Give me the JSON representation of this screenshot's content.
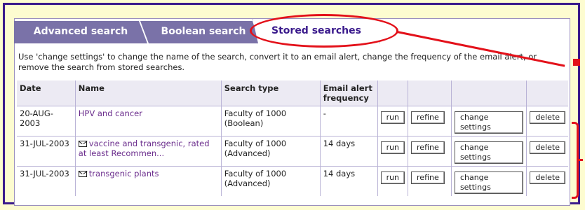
{
  "tabs": [
    {
      "label": "Advanced search"
    },
    {
      "label": "Boolean search"
    },
    {
      "label": "Stored searches"
    }
  ],
  "intro": "Use 'change settings' to change the name of the search, convert it to an email alert, change the frequency of the email alert, or remove the search from stored searches.",
  "table": {
    "headers": {
      "date": "Date",
      "name": "Name",
      "type": "Search type",
      "freq_line1": "Email alert",
      "freq_line2": "frequency"
    },
    "rows": [
      {
        "date": "20-AUG-2003",
        "email_alert": false,
        "name": "HPV and cancer",
        "type_line1": "Faculty of 1000",
        "type_line2": "(Boolean)",
        "freq": "-"
      },
      {
        "date": "31-JUL-2003",
        "email_alert": true,
        "name": "vaccine and transgenic, rated at least Recommen...",
        "type_line1": "Faculty of 1000",
        "type_line2": "(Advanced)",
        "freq": "14 days"
      },
      {
        "date": "31-JUL-2003",
        "email_alert": true,
        "name": "transgenic plants",
        "type_line1": "Faculty of 1000",
        "type_line2": "(Advanced)",
        "freq": "14 days"
      }
    ],
    "buttons": {
      "run": "run",
      "refine": "refine",
      "change_settings": "change settings",
      "delete": "delete"
    }
  },
  "icons": {
    "email_alert": "envelope-icon"
  },
  "colors": {
    "frame": "#3a1a8c",
    "tab_inactive": "#7a72a8",
    "annotation": "#e3111a",
    "link": "#6a2c8c"
  }
}
